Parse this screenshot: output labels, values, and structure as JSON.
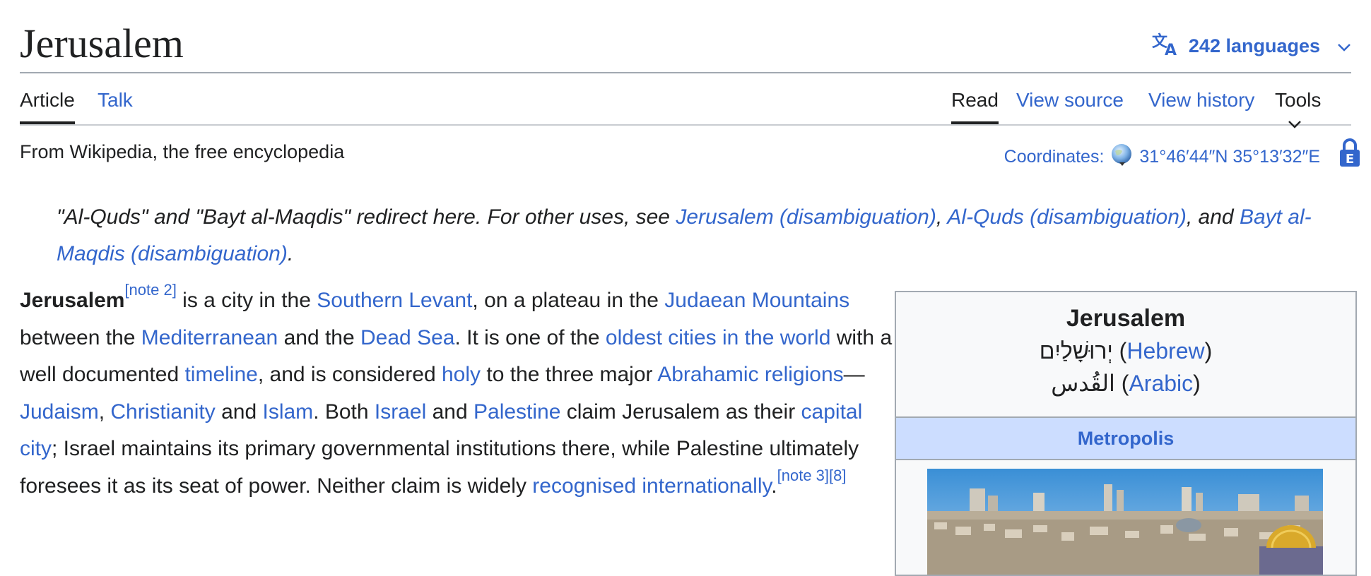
{
  "title": "Jerusalem",
  "languages": {
    "label": "242 languages"
  },
  "tabs": {
    "left": [
      "Article",
      "Talk"
    ],
    "right": [
      "Read",
      "View source",
      "View history",
      "Tools"
    ]
  },
  "tagline": "From Wikipedia, the free encyclopedia",
  "coordinates": {
    "label": "Coordinates:",
    "value": "31°46′44″N 35°13′32″E"
  },
  "hatnote": {
    "text1": "\"Al-Quds\" and \"Bayt al-Maqdis\" redirect here. For other uses, see ",
    "link1": "Jerusalem (disambiguation)",
    "sep1": ", ",
    "link2": "Al-Quds (disambiguation)",
    "sep2": ", and ",
    "link3": "Bayt al-Maqdis (disambiguation)",
    "end": "."
  },
  "lead": {
    "t0": "Jerusalem",
    "n0": "[note 2]",
    "t1": " is a city in the ",
    "l1": "Southern Levant",
    "t2": ", on a plateau in the ",
    "l2": "Judaean Mountains",
    "t3": " between the ",
    "l3": "Mediterranean",
    "t4": " and the ",
    "l4": "Dead Sea",
    "t5": ". It is one of the ",
    "l5": "oldest cities in the world",
    "t6": " with a well documented ",
    "l6": "timeline",
    "t7": ", and is considered ",
    "l7": "holy",
    "t8": " to the three major ",
    "l8": "Abrahamic religions",
    "t9": "—",
    "l9": "Judaism",
    "t10": ", ",
    "l10": "Christianity",
    "t11": " and ",
    "l11": "Islam",
    "t12": ". Both ",
    "l12": "Israel",
    "t13": " and ",
    "l13": "Palestine",
    "t14": " claim Jerusalem as their ",
    "l14": "capital city",
    "t15": "; Israel maintains its primary governmental institutions there, while Palestine ultimately foresees it as its seat of power. Neither claim is widely ",
    "l15": "recognised internationally",
    "t16": ".",
    "n1": "[note 3][8]"
  },
  "infobox": {
    "title": "Jerusalem",
    "hebrew_native": "יְרוּשָׁלַיִם",
    "hebrew_label": "Hebrew",
    "arabic_native": "القُدس",
    "arabic_label": "Arabic",
    "band": "Metropolis",
    "open_paren": "(",
    "close_paren": ")"
  },
  "icons": [
    "translate-icon",
    "chevron-down-icon",
    "globe-icon",
    "lock-icon"
  ],
  "colors": {
    "link": "#3366cc",
    "band": "#ccddff",
    "text": "#202122",
    "border": "#a2a9b1"
  }
}
